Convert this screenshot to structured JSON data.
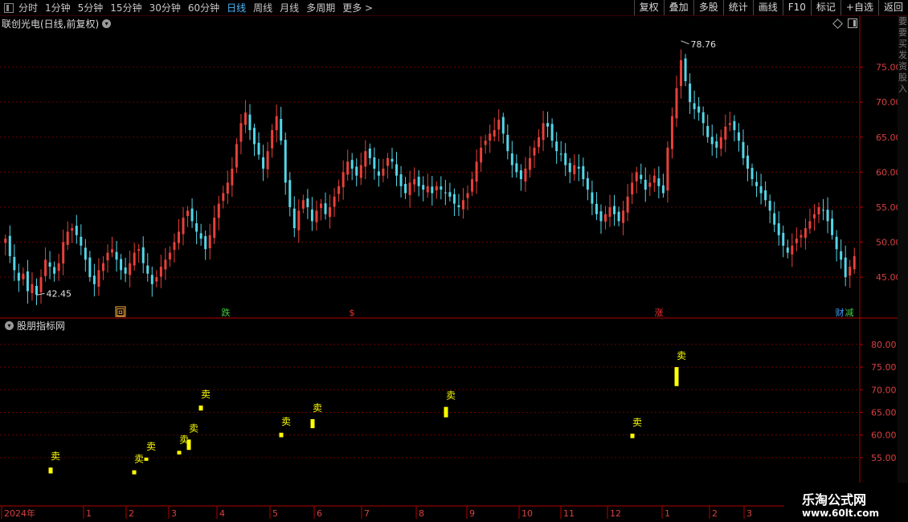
{
  "toolbar": {
    "period_tabs": [
      "分时",
      "1分钟",
      "5分钟",
      "15分钟",
      "30分钟",
      "60分钟",
      "日线",
      "周线",
      "月线",
      "多周期",
      "更多 >"
    ],
    "active_tab": "日线",
    "right_buttons": [
      "复权",
      "叠加",
      "多股",
      "统计",
      "画线",
      "F10",
      "标记",
      "+自选",
      "返回"
    ]
  },
  "stock": {
    "title": "联创光电(日线,前复权)"
  },
  "indicator": {
    "title": "股朋指标网"
  },
  "colors": {
    "up": "#e8403a",
    "down": "#54d6e8",
    "signal": "#ffff00",
    "grid": "#6a0000",
    "axis": "#b00000"
  },
  "right_strip_text": "要要买发资股入",
  "watermark": {
    "line1": "乐淘公式网",
    "line2": "www.60lt.com"
  },
  "chart_data": [
    {
      "type": "candlestick",
      "title": "联创光电(日线,前复权)",
      "y_ticks": [
        45.0,
        50.0,
        55.0,
        60.0,
        65.0,
        70.0,
        75.0
      ],
      "ylim": [
        41.0,
        80.0
      ],
      "annotations": [
        {
          "text": "78.76",
          "value": 78.76,
          "position": "peak"
        },
        {
          "text": "42.45",
          "value": 42.45,
          "position": "trough"
        }
      ],
      "event_markers": [
        {
          "text": "回",
          "color": "#ffb040"
        },
        {
          "text": "跌",
          "color": "#40d040"
        },
        {
          "text": "$",
          "color": "#ff3030"
        },
        {
          "text": "涨",
          "color": "#ff3030"
        },
        {
          "text": "财",
          "color": "#40a0ff"
        },
        {
          "text": "减",
          "color": "#40d040"
        }
      ],
      "close_series": [
        50.5,
        48.0,
        46.0,
        44.5,
        45.5,
        43.0,
        44.0,
        42.5,
        45.0,
        47.5,
        46.5,
        45.5,
        47.0,
        50.0,
        51.5,
        52.0,
        51.0,
        49.5,
        47.5,
        45.0,
        44.0,
        46.0,
        47.0,
        48.5,
        49.0,
        47.5,
        46.0,
        45.5,
        47.0,
        48.5,
        49.0,
        47.0,
        45.5,
        44.0,
        45.0,
        46.5,
        47.5,
        48.5,
        50.0,
        51.5,
        53.5,
        54.5,
        53.0,
        51.5,
        50.5,
        49.0,
        51.0,
        53.5,
        55.5,
        57.0,
        58.5,
        60.5,
        64.0,
        67.0,
        68.5,
        66.0,
        64.0,
        62.5,
        60.5,
        63.0,
        66.0,
        68.0,
        64.5,
        58.5,
        55.0,
        52.0,
        54.5,
        56.0,
        55.0,
        53.0,
        54.5,
        55.5,
        54.0,
        55.0,
        56.5,
        58.0,
        60.0,
        61.5,
        60.5,
        59.5,
        61.0,
        63.0,
        62.0,
        60.5,
        59.5,
        60.5,
        62.0,
        61.5,
        59.5,
        58.0,
        57.0,
        58.5,
        59.0,
        58.0,
        57.5,
        58.0,
        57.0,
        58.0,
        57.5,
        57.0,
        56.5,
        55.5,
        55.0,
        56.0,
        57.0,
        59.0,
        61.5,
        63.5,
        64.5,
        65.5,
        66.0,
        67.5,
        65.5,
        63.0,
        61.0,
        60.0,
        59.0,
        60.5,
        62.0,
        63.5,
        65.0,
        67.0,
        66.5,
        64.5,
        63.0,
        62.5,
        61.0,
        60.0,
        61.0,
        60.5,
        59.0,
        57.5,
        55.5,
        54.0,
        53.0,
        54.0,
        55.0,
        54.0,
        53.0,
        54.5,
        56.5,
        58.5,
        60.0,
        59.0,
        57.5,
        58.5,
        59.5,
        58.0,
        57.0,
        63.5,
        68.0,
        72.0,
        76.0,
        73.0,
        70.0,
        69.0,
        68.5,
        67.0,
        65.0,
        64.0,
        63.5,
        65.0,
        66.5,
        67.0,
        66.0,
        64.5,
        62.0,
        60.5,
        59.0,
        58.0,
        57.0,
        56.0,
        54.5,
        52.5,
        51.0,
        49.5,
        48.5,
        49.5,
        50.5,
        51.0,
        52.0,
        53.0,
        54.0,
        55.0,
        54.5,
        53.0,
        51.0,
        49.0,
        47.5,
        45.0,
        46.5,
        48.0
      ]
    },
    {
      "type": "bar",
      "title": "股朋指标网",
      "y_ticks": [
        55.0,
        60.0,
        65.0,
        70.0,
        75.0,
        80.0
      ],
      "ylim": [
        50.0,
        83.0
      ],
      "signals": [
        {
          "label": "卖",
          "low": 51.5,
          "high": 52.8
        },
        {
          "label": "卖",
          "low": 51.3,
          "high": 52.2
        },
        {
          "label": "卖",
          "low": 54.3,
          "high": 55.0
        },
        {
          "label": "卖",
          "low": 55.7,
          "high": 56.5
        },
        {
          "label": "卖",
          "low": 56.7,
          "high": 59.0
        },
        {
          "label": "卖",
          "low": 65.4,
          "high": 66.5
        },
        {
          "label": "卖",
          "low": 59.5,
          "high": 60.5
        },
        {
          "label": "卖",
          "low": 61.5,
          "high": 63.5
        },
        {
          "label": "卖",
          "low": 63.9,
          "high": 66.2
        },
        {
          "label": "卖",
          "low": 59.3,
          "high": 60.3
        },
        {
          "label": "卖",
          "low": 70.8,
          "high": 75.0
        }
      ],
      "x_labels": [
        "2024年",
        "1",
        "2",
        "3",
        "4",
        "5",
        "6",
        "7",
        "8",
        "9",
        "10",
        "11",
        "12",
        "1",
        "2",
        "3"
      ]
    }
  ]
}
